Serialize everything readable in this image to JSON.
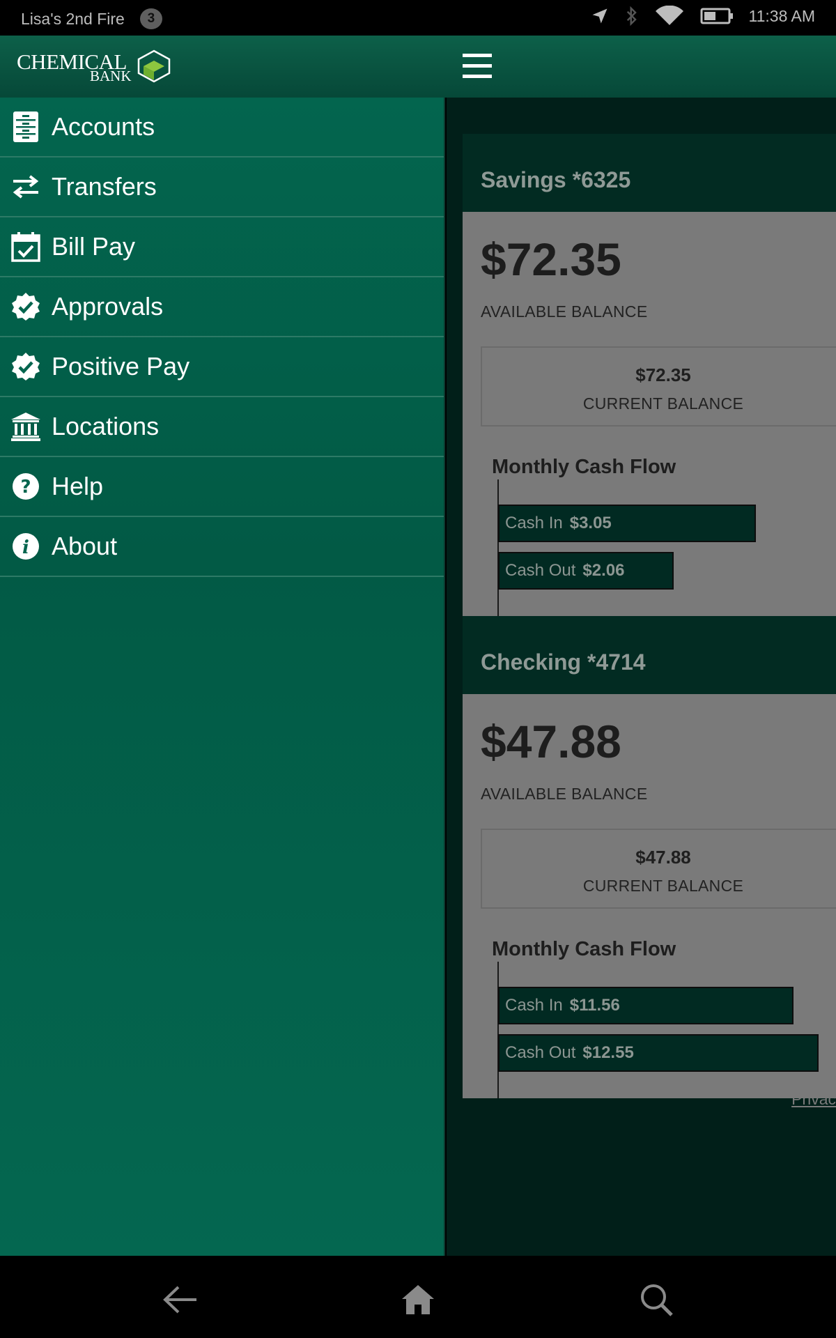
{
  "status_bar": {
    "device_name": "Lisa's 2nd Fire",
    "notification_count": "3",
    "time": "11:38 AM"
  },
  "header": {
    "logo_line1": "CHEMICAL",
    "logo_line2": "BANK",
    "menu_icon": "hamburger-icon"
  },
  "drawer": {
    "items": [
      {
        "label": "Accounts",
        "icon": "accounts-icon"
      },
      {
        "label": "Transfers",
        "icon": "transfers-icon"
      },
      {
        "label": "Bill Pay",
        "icon": "calendar-check-icon"
      },
      {
        "label": "Approvals",
        "icon": "check-badge-icon"
      },
      {
        "label": "Positive Pay",
        "icon": "check-badge-icon"
      },
      {
        "label": "Locations",
        "icon": "bank-building-icon"
      },
      {
        "label": "Help",
        "icon": "question-icon"
      },
      {
        "label": "About",
        "icon": "info-icon"
      }
    ]
  },
  "accounts": [
    {
      "name": "Savings *6325",
      "available_balance": "$72.35",
      "available_label": "AVAILABLE BALANCE",
      "current_balance": "$72.35",
      "current_label": "CURRENT BALANCE",
      "cash_flow_title": "Monthly Cash Flow",
      "cash_in_label": "Cash In",
      "cash_in": "$3.05",
      "cash_out_label": "Cash Out",
      "cash_out": "$2.06"
    },
    {
      "name": "Checking *4714",
      "available_balance": "$47.88",
      "available_label": "AVAILABLE BALANCE",
      "current_balance": "$47.88",
      "current_label": "CURRENT BALANCE",
      "cash_flow_title": "Monthly Cash Flow",
      "cash_in_label": "Cash In",
      "cash_in": "$11.56",
      "cash_out_label": "Cash Out",
      "cash_out": "$12.55"
    }
  ],
  "footer": {
    "link1": "Priv",
    "link2": "Privac"
  },
  "nav_bar": {
    "back": "back-arrow-icon",
    "home": "home-icon",
    "search": "search-icon"
  },
  "colors": {
    "drawer_bg": "#025a45",
    "header_bg": "#0d6049",
    "bar_fill": "#012a22"
  }
}
